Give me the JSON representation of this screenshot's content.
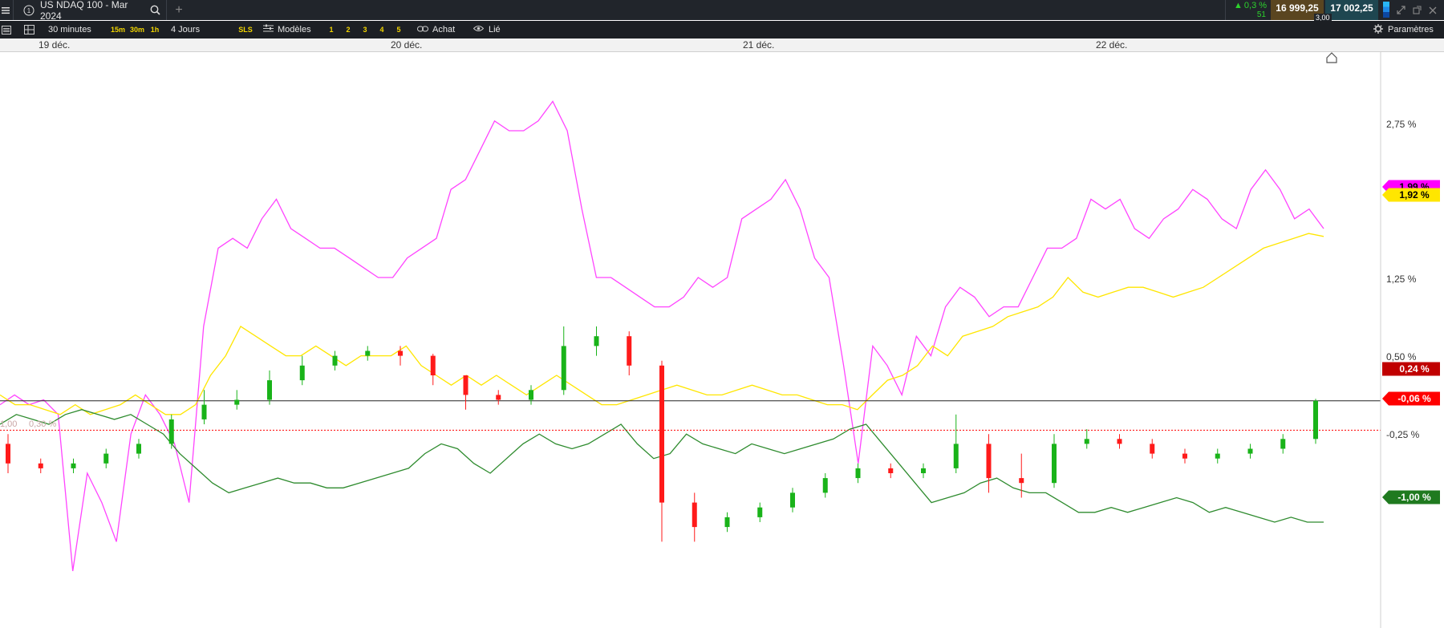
{
  "header": {
    "instrument": "US NDAQ 100 - Mar 2024",
    "change_pct": "0,3 %",
    "change_count": "51",
    "bid": "16 999,25",
    "ask": "17 002,25",
    "spread": "3,00"
  },
  "toolbar": {
    "interval": "30 minutes",
    "quick_intervals": [
      "15m",
      "30m",
      "1h"
    ],
    "period": "4 Jours",
    "sls": "SLS",
    "models_label": "Modèles",
    "model_slots": [
      "1",
      "2",
      "3",
      "4",
      "5"
    ],
    "achat_label": "Achat",
    "lie_label": "Lié",
    "params_label": "Paramètres"
  },
  "dates": [
    "19 déc.",
    "20 déc.",
    "21 déc.",
    "22 déc."
  ],
  "chart_data": {
    "type": "line",
    "y_axis_ticks": [
      "2,75 %",
      "1,25 %",
      "0,50 %",
      "-0,25 %"
    ],
    "left_labels": [
      "1,00",
      "0,30 %"
    ],
    "x_labels": [
      "19 déc.",
      "20 déc.",
      "21 déc.",
      "22 déc."
    ],
    "series": [
      {
        "color": "#ff44ff",
        "last_label": "1,99 %",
        "values": [
          0.2,
          0.3,
          0.2,
          0.25,
          0.1,
          -1.5,
          -0.5,
          -0.8,
          -1.2,
          -0.1,
          0.3,
          0.1,
          -0.2,
          -0.8,
          1.0,
          1.8,
          1.9,
          1.8,
          2.1,
          2.3,
          2.0,
          1.9,
          1.8,
          1.8,
          1.7,
          1.6,
          1.5,
          1.5,
          1.7,
          1.8,
          1.9,
          2.4,
          2.5,
          2.8,
          3.1,
          3.0,
          3.0,
          3.1,
          3.3,
          3.0,
          2.2,
          1.5,
          1.5,
          1.4,
          1.3,
          1.2,
          1.2,
          1.3,
          1.5,
          1.4,
          1.5,
          2.1,
          2.2,
          2.3,
          2.5,
          2.2,
          1.7,
          1.5,
          0.6,
          -0.4,
          0.8,
          0.6,
          0.3,
          0.9,
          0.7,
          1.2,
          1.4,
          1.3,
          1.1,
          1.2,
          1.2,
          1.5,
          1.8,
          1.8,
          1.9,
          2.3,
          2.2,
          2.3,
          2.0,
          1.9,
          2.1,
          2.2,
          2.4,
          2.3,
          2.1,
          2.0,
          2.4,
          2.6,
          2.4,
          2.1,
          2.2,
          2.0
        ]
      },
      {
        "color": "#ffe600",
        "last_label": "1,92 %",
        "values": [
          0.3,
          0.2,
          0.2,
          0.15,
          0.1,
          0.2,
          0.1,
          0.15,
          0.2,
          0.3,
          0.2,
          0.1,
          0.1,
          0.2,
          0.5,
          0.7,
          1.0,
          0.9,
          0.8,
          0.7,
          0.7,
          0.8,
          0.7,
          0.6,
          0.7,
          0.7,
          0.7,
          0.8,
          0.6,
          0.5,
          0.4,
          0.5,
          0.4,
          0.5,
          0.4,
          0.3,
          0.4,
          0.5,
          0.4,
          0.3,
          0.2,
          0.2,
          0.25,
          0.3,
          0.35,
          0.4,
          0.35,
          0.3,
          0.3,
          0.35,
          0.4,
          0.35,
          0.3,
          0.3,
          0.25,
          0.2,
          0.2,
          0.15,
          0.3,
          0.45,
          0.5,
          0.6,
          0.8,
          0.7,
          0.9,
          0.95,
          1.0,
          1.1,
          1.15,
          1.2,
          1.3,
          1.5,
          1.35,
          1.3,
          1.35,
          1.4,
          1.4,
          1.35,
          1.3,
          1.35,
          1.4,
          1.5,
          1.6,
          1.7,
          1.8,
          1.85,
          1.9,
          1.95,
          1.92
        ]
      },
      {
        "color": "#2e8b2e",
        "last_label": "-1,00 %",
        "values": [
          0.0,
          0.1,
          0.05,
          0.0,
          0.1,
          0.15,
          0.1,
          0.05,
          0.1,
          0.0,
          -0.1,
          -0.3,
          -0.45,
          -0.6,
          -0.7,
          -0.65,
          -0.6,
          -0.55,
          -0.6,
          -0.6,
          -0.65,
          -0.65,
          -0.6,
          -0.55,
          -0.5,
          -0.45,
          -0.3,
          -0.2,
          -0.25,
          -0.4,
          -0.5,
          -0.35,
          -0.2,
          -0.1,
          -0.2,
          -0.25,
          -0.2,
          -0.1,
          0.0,
          -0.2,
          -0.35,
          -0.3,
          -0.1,
          -0.2,
          -0.25,
          -0.3,
          -0.2,
          -0.25,
          -0.3,
          -0.25,
          -0.2,
          -0.15,
          -0.05,
          0.0,
          -0.2,
          -0.4,
          -0.6,
          -0.8,
          -0.75,
          -0.7,
          -0.6,
          -0.55,
          -0.65,
          -0.7,
          -0.7,
          -0.8,
          -0.9,
          -0.9,
          -0.85,
          -0.9,
          -0.85,
          -0.8,
          -0.75,
          -0.8,
          -0.9,
          -0.85,
          -0.9,
          -0.95,
          -1.0,
          -0.95,
          -1.0,
          -1.0
        ]
      },
      {
        "color": "#222222",
        "last_label": "0,24 %",
        "values": [
          0.24
        ]
      },
      {
        "color": "#ff0000",
        "last_label": "-0,06 %",
        "values": [
          -0.06
        ]
      }
    ],
    "candles": [
      {
        "o": -0.2,
        "c": -0.4,
        "h": -0.1,
        "l": -0.5
      },
      {
        "o": -0.4,
        "c": -0.45,
        "h": -0.35,
        "l": -0.5
      },
      {
        "o": -0.45,
        "c": -0.4,
        "h": -0.35,
        "l": -0.5
      },
      {
        "o": -0.4,
        "c": -0.3,
        "h": -0.25,
        "l": -0.45
      },
      {
        "o": -0.3,
        "c": -0.2,
        "h": -0.15,
        "l": -0.35
      },
      {
        "o": -0.2,
        "c": 0.05,
        "h": 0.1,
        "l": -0.25
      },
      {
        "o": 0.05,
        "c": 0.2,
        "h": 0.35,
        "l": 0.0
      },
      {
        "o": 0.2,
        "c": 0.25,
        "h": 0.35,
        "l": 0.15
      },
      {
        "o": 0.25,
        "c": 0.45,
        "h": 0.55,
        "l": 0.2
      },
      {
        "o": 0.45,
        "c": 0.6,
        "h": 0.7,
        "l": 0.4
      },
      {
        "o": 0.6,
        "c": 0.7,
        "h": 0.75,
        "l": 0.55
      },
      {
        "o": 0.7,
        "c": 0.75,
        "h": 0.8,
        "l": 0.65
      },
      {
        "o": 0.75,
        "c": 0.7,
        "h": 0.8,
        "l": 0.6
      },
      {
        "o": 0.7,
        "c": 0.5,
        "h": 0.72,
        "l": 0.4
      },
      {
        "o": 0.5,
        "c": 0.3,
        "h": 0.5,
        "l": 0.15
      },
      {
        "o": 0.3,
        "c": 0.25,
        "h": 0.35,
        "l": 0.2
      },
      {
        "o": 0.25,
        "c": 0.35,
        "h": 0.4,
        "l": 0.2
      },
      {
        "o": 0.35,
        "c": 0.8,
        "h": 1.0,
        "l": 0.3
      },
      {
        "o": 0.8,
        "c": 0.9,
        "h": 1.0,
        "l": 0.7
      },
      {
        "o": 0.9,
        "c": 0.6,
        "h": 0.95,
        "l": 0.5
      },
      {
        "o": 0.6,
        "c": -0.8,
        "h": 0.65,
        "l": -1.2
      },
      {
        "o": -0.8,
        "c": -1.05,
        "h": -0.7,
        "l": -1.2
      },
      {
        "o": -1.05,
        "c": -0.95,
        "h": -0.9,
        "l": -1.1
      },
      {
        "o": -0.95,
        "c": -0.85,
        "h": -0.8,
        "l": -1.0
      },
      {
        "o": -0.85,
        "c": -0.7,
        "h": -0.65,
        "l": -0.9
      },
      {
        "o": -0.7,
        "c": -0.55,
        "h": -0.5,
        "l": -0.75
      },
      {
        "o": -0.55,
        "c": -0.45,
        "h": -0.4,
        "l": -0.6
      },
      {
        "o": -0.45,
        "c": -0.5,
        "h": -0.4,
        "l": -0.55
      },
      {
        "o": -0.5,
        "c": -0.45,
        "h": -0.4,
        "l": -0.55
      },
      {
        "o": -0.45,
        "c": -0.2,
        "h": 0.1,
        "l": -0.5
      },
      {
        "o": -0.2,
        "c": -0.55,
        "h": -0.1,
        "l": -0.7
      },
      {
        "o": -0.55,
        "c": -0.6,
        "h": -0.3,
        "l": -0.75
      },
      {
        "o": -0.6,
        "c": -0.2,
        "h": -0.1,
        "l": -0.65
      },
      {
        "o": -0.2,
        "c": -0.15,
        "h": -0.05,
        "l": -0.25
      },
      {
        "o": -0.15,
        "c": -0.2,
        "h": -0.1,
        "l": -0.25
      },
      {
        "o": -0.2,
        "c": -0.3,
        "h": -0.15,
        "l": -0.35
      },
      {
        "o": -0.3,
        "c": -0.35,
        "h": -0.25,
        "l": -0.4
      },
      {
        "o": -0.35,
        "c": -0.3,
        "h": -0.25,
        "l": -0.4
      },
      {
        "o": -0.3,
        "c": -0.25,
        "h": -0.2,
        "l": -0.35
      },
      {
        "o": -0.25,
        "c": -0.15,
        "h": -0.1,
        "l": -0.3
      },
      {
        "o": -0.15,
        "c": 0.24,
        "h": 0.26,
        "l": -0.2
      }
    ]
  }
}
